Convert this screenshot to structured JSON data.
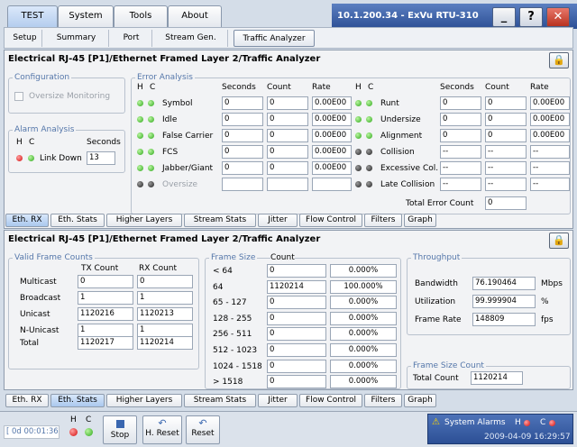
{
  "top_tabs": [
    "TEST",
    "System",
    "Tools",
    "About"
  ],
  "window_title": "10.1.200.34 - ExVu RTU-310",
  "window_buttons": [
    "_",
    "?",
    "✕"
  ],
  "sub_tabs": [
    "Setup",
    "Summary",
    "Port",
    "Stream Gen.",
    "Traffic Analyzer"
  ],
  "panel_title": "Electrical RJ-45 [P1]/Ethernet Framed Layer 2/Traffic Analyzer",
  "rx": {
    "config_label": "Configuration",
    "oversize_monitoring": "Oversize Monitoring",
    "alarm_label": "Alarm Analysis",
    "h": "H",
    "c": "C",
    "seconds": "Seconds",
    "link_down": "Link Down",
    "link_down_seconds": "13",
    "error_label": "Error Analysis",
    "col_seconds": "Seconds",
    "col_count": "Count",
    "col_rate": "Rate",
    "left_rows": [
      {
        "name": "Symbol",
        "h": "green",
        "c": "green",
        "seconds": "0",
        "count": "0",
        "rate": "0.00E00"
      },
      {
        "name": "Idle",
        "h": "green",
        "c": "green",
        "seconds": "0",
        "count": "0",
        "rate": "0.00E00"
      },
      {
        "name": "False Carrier",
        "h": "green",
        "c": "green",
        "seconds": "0",
        "count": "0",
        "rate": "0.00E00"
      },
      {
        "name": "FCS",
        "h": "green",
        "c": "green",
        "seconds": "0",
        "count": "0",
        "rate": "0.00E00"
      },
      {
        "name": "Jabber/Giant",
        "h": "green",
        "c": "green",
        "seconds": "0",
        "count": "0",
        "rate": "0.00E00"
      },
      {
        "name": "Oversize",
        "h": "black",
        "c": "black",
        "seconds": "",
        "count": "",
        "rate": ""
      }
    ],
    "right_rows": [
      {
        "name": "Runt",
        "h": "green",
        "c": "green",
        "seconds": "0",
        "count": "0",
        "rate": "0.00E00"
      },
      {
        "name": "Undersize",
        "h": "green",
        "c": "green",
        "seconds": "0",
        "count": "0",
        "rate": "0.00E00"
      },
      {
        "name": "Alignment",
        "h": "green",
        "c": "green",
        "seconds": "0",
        "count": "0",
        "rate": "0.00E00"
      },
      {
        "name": "Collision",
        "h": "black",
        "c": "black",
        "seconds": "--",
        "count": "--",
        "rate": "--"
      },
      {
        "name": "Excessive Col.",
        "h": "black",
        "c": "black",
        "seconds": "--",
        "count": "--",
        "rate": "--"
      },
      {
        "name": "Late Collision",
        "h": "black",
        "c": "black",
        "seconds": "--",
        "count": "--",
        "rate": "--"
      }
    ],
    "total_error_label": "Total Error Count",
    "total_error_value": "0"
  },
  "bottom_tabs": [
    "Eth. RX",
    "Eth. Stats",
    "Higher Layers",
    "Stream Stats",
    "Jitter",
    "Flow Control",
    "Filters",
    "Graph"
  ],
  "stats": {
    "vfc_label": "Valid Frame Counts",
    "tx_count": "TX Count",
    "rx_count": "RX Count",
    "rows": [
      {
        "name": "Multicast",
        "tx": "0",
        "rx": "0"
      },
      {
        "name": "Broadcast",
        "tx": "1",
        "rx": "1"
      },
      {
        "name": "Unicast",
        "tx": "1120216",
        "rx": "1120213"
      },
      {
        "name": "N-Unicast",
        "tx": "1",
        "rx": "1"
      },
      {
        "name": "Total",
        "tx": "1120217",
        "rx": "1120214"
      }
    ],
    "fs_label": "Frame Size",
    "fs_count": "Count",
    "fs_rows": [
      {
        "name": "< 64",
        "count": "0",
        "pct": "0.000%"
      },
      {
        "name": "64",
        "count": "1120214",
        "pct": "100.000%"
      },
      {
        "name": "65 - 127",
        "count": "0",
        "pct": "0.000%"
      },
      {
        "name": "128 - 255",
        "count": "0",
        "pct": "0.000%"
      },
      {
        "name": "256 - 511",
        "count": "0",
        "pct": "0.000%"
      },
      {
        "name": "512 - 1023",
        "count": "0",
        "pct": "0.000%"
      },
      {
        "name": "1024 - 1518",
        "count": "0",
        "pct": "0.000%"
      },
      {
        "name": "> 1518",
        "count": "0",
        "pct": "0.000%"
      }
    ],
    "tp_label": "Throughput",
    "tp_rows": [
      {
        "name": "Bandwidth",
        "value": "76.190464",
        "unit": "Mbps"
      },
      {
        "name": "Utilization",
        "value": "99.999904",
        "unit": "%"
      },
      {
        "name": "Frame Rate",
        "value": "148809",
        "unit": "fps"
      }
    ],
    "fsc_label": "Frame Size Count",
    "total_count_label": "Total Count",
    "total_count_value": "1120214"
  },
  "footer": {
    "timer": "[ 0d 00:01:36 ]",
    "h": "H",
    "c": "C",
    "stop": "Stop",
    "h_reset": "H. Reset",
    "reset": "Reset",
    "system_alarms": "System Alarms",
    "sa_h": "H",
    "sa_c": "C",
    "datetime": "2009-04-09 16:29:57"
  },
  "colors": {
    "accent": "#2c4f95",
    "green_led": "#2ea81b",
    "red_led": "#d40c0c",
    "group_label": "#5577aa"
  }
}
